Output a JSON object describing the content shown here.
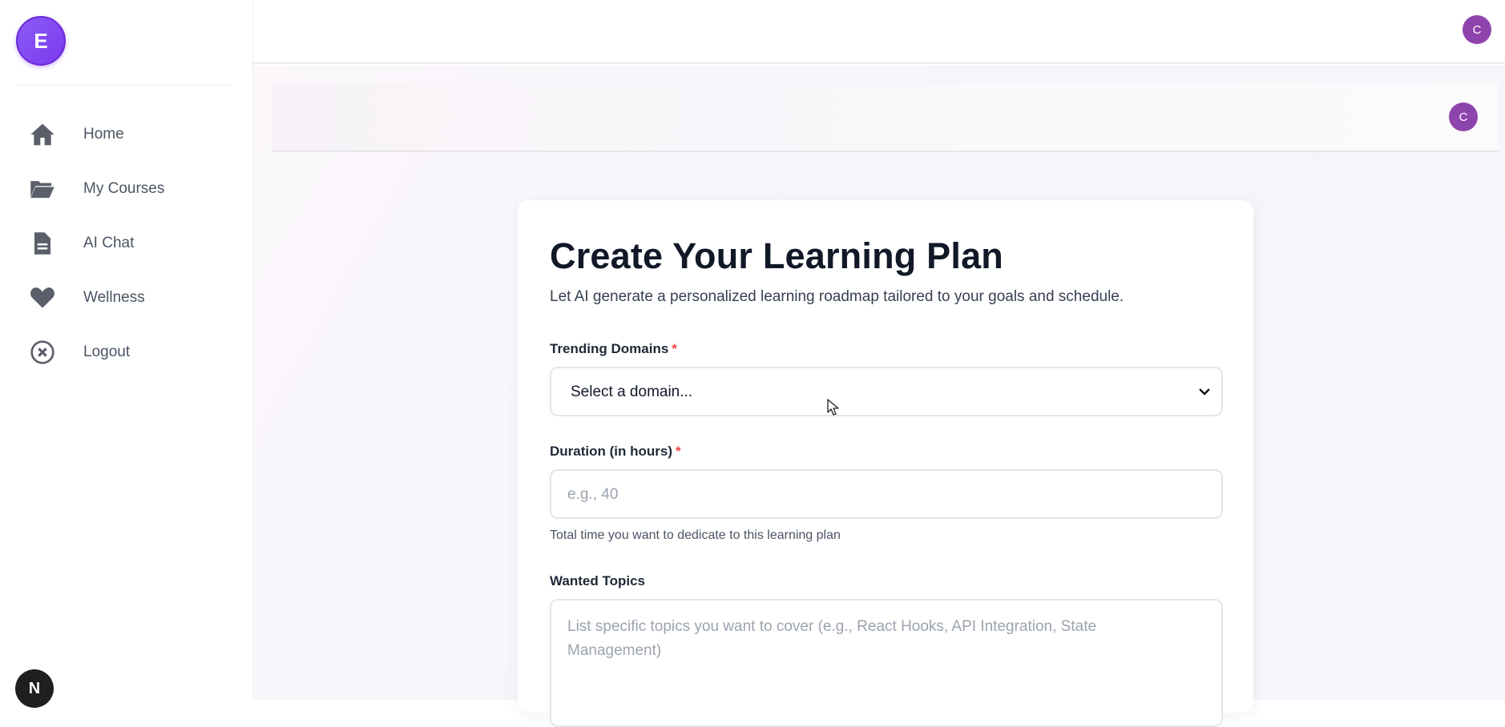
{
  "sidebar": {
    "logo_letter": "E",
    "items": [
      {
        "label": "Home",
        "icon": "home-icon"
      },
      {
        "label": "My Courses",
        "icon": "folder-icon"
      },
      {
        "label": "AI Chat",
        "icon": "document-icon"
      },
      {
        "label": "Wellness",
        "icon": "heart-icon"
      },
      {
        "label": "Logout",
        "icon": "close-circle-icon"
      }
    ],
    "bottom_badge": "N"
  },
  "topbar": {
    "avatar_letter": "C"
  },
  "subheader": {
    "avatar_letter": "C"
  },
  "form": {
    "title": "Create Your Learning Plan",
    "subtitle": "Let AI generate a personalized learning roadmap tailored to your goals and schedule.",
    "domain_label": "Trending Domains",
    "domain_required": "*",
    "domain_value": "Select a domain...",
    "duration_label": "Duration (in hours)",
    "duration_required": "*",
    "duration_placeholder": "e.g., 40",
    "duration_help": "Total time you want to dedicate to this learning plan",
    "topics_label": "Wanted Topics",
    "topics_placeholder": "List specific topics you want to cover (e.g., React Hooks, API Integration, State Management)"
  },
  "colors": {
    "accent": "#7c3aed",
    "avatar": "#8e44ad",
    "required": "#ef4444"
  }
}
